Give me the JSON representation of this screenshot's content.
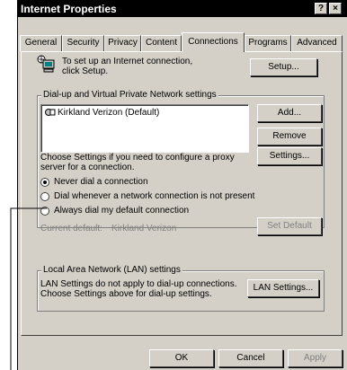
{
  "window": {
    "title": "Internet Properties",
    "help_label": "?",
    "close_label": "×"
  },
  "tabs": [
    {
      "label": "General"
    },
    {
      "label": "Security"
    },
    {
      "label": "Privacy"
    },
    {
      "label": "Content"
    },
    {
      "label": "Connections"
    },
    {
      "label": "Programs"
    },
    {
      "label": "Advanced"
    }
  ],
  "active_tab": "Connections",
  "setup": {
    "text": "To set up an Internet connection, click Setup.",
    "button": "Setup..."
  },
  "dialup": {
    "group_label": "Dial-up and Virtual Private Network settings",
    "connections": [
      "Kirkland Verizon (Default)"
    ],
    "add_button": "Add...",
    "remove_button": "Remove",
    "settings_text": "Choose Settings if you need to configure a proxy server for a connection.",
    "settings_button": "Settings...",
    "options": [
      {
        "label": "Never dial a connection",
        "selected": true
      },
      {
        "label": "Dial whenever a network connection is not present",
        "selected": false
      },
      {
        "label": "Always dial my default connection",
        "selected": false
      }
    ],
    "current_default_label": "Current default:",
    "current_default_value": "Kirkland Verizon",
    "set_default_button": "Set Default"
  },
  "lan": {
    "group_label": "Local Area Network (LAN) settings",
    "text": "LAN Settings do not apply to dial-up connections. Choose Settings above for dial-up settings.",
    "button": "LAN Settings..."
  },
  "footer": {
    "ok": "OK",
    "cancel": "Cancel",
    "apply": "Apply"
  }
}
